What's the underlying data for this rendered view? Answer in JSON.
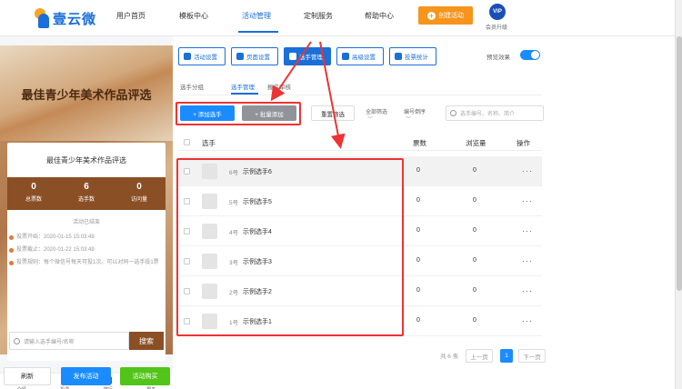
{
  "brand": {
    "name": "壹云微"
  },
  "nav": {
    "items": [
      "用户首页",
      "模板中心",
      "活动管理",
      "定制服务",
      "帮助中心"
    ],
    "create_label": "创建活动",
    "vip_badge": "VIP",
    "vip_label": "会员升级"
  },
  "preview": {
    "banner_title": "最佳青少年美术作品评选",
    "card_title": "最佳青少年美术作品评选",
    "stats": [
      {
        "value": "0",
        "label": "总票数"
      },
      {
        "value": "6",
        "label": "选手数"
      },
      {
        "value": "0",
        "label": "访问量"
      }
    ],
    "status": "活动已结束",
    "info": [
      "投票开始：2020-01-15 15:03:49",
      "投票截止：2020-01-22 15:03:49",
      "投票规则：每个微信号每天可投1次。可以对同一选手投1票"
    ],
    "search_placeholder": "请输入选手编号/名称",
    "search_label": "搜索",
    "tabs": [
      "介绍",
      "投票",
      "排行",
      "报名"
    ]
  },
  "bottom": {
    "refresh": "刷新",
    "publish": "发布活动",
    "buy": "活动购买"
  },
  "toolbar": {
    "buttons": [
      "活动设置",
      "页面设置",
      "选手管理",
      "高级设置",
      "投票统计"
    ],
    "preview_label": "预览效果"
  },
  "subtabs": [
    "选手分组",
    "选手管理",
    "报名审核"
  ],
  "actions": {
    "add": "+ 添加选手",
    "batch": "+ 批量添加",
    "reset": "重置筛选",
    "filter_all": "全部筛选",
    "filter_sort": "编号倒序",
    "search_placeholder": "选手编号、名称、简介"
  },
  "table": {
    "headers": [
      "选手",
      "票数",
      "浏览量",
      "操作"
    ],
    "rows": [
      {
        "num": "6号",
        "name": "示例选手6",
        "votes": "0",
        "views": "0",
        "ops": "···"
      },
      {
        "num": "5号",
        "name": "示例选手5",
        "votes": "0",
        "views": "0",
        "ops": "···"
      },
      {
        "num": "4号",
        "name": "示例选手4",
        "votes": "0",
        "views": "0",
        "ops": "···"
      },
      {
        "num": "3号",
        "name": "示例选手3",
        "votes": "0",
        "views": "0",
        "ops": "···"
      },
      {
        "num": "2号",
        "name": "示例选手2",
        "votes": "0",
        "views": "0",
        "ops": "···"
      },
      {
        "num": "1号",
        "name": "示例选手1",
        "votes": "0",
        "views": "0",
        "ops": "···"
      }
    ]
  },
  "pagination": {
    "total": "共 6 条",
    "prev": "上一页",
    "current": "1",
    "next": "下一页"
  },
  "colors": {
    "primary": "#1a6fd8",
    "accent": "#f7941d",
    "annotation": "#e33333",
    "brand_brown": "#8a4f25"
  }
}
